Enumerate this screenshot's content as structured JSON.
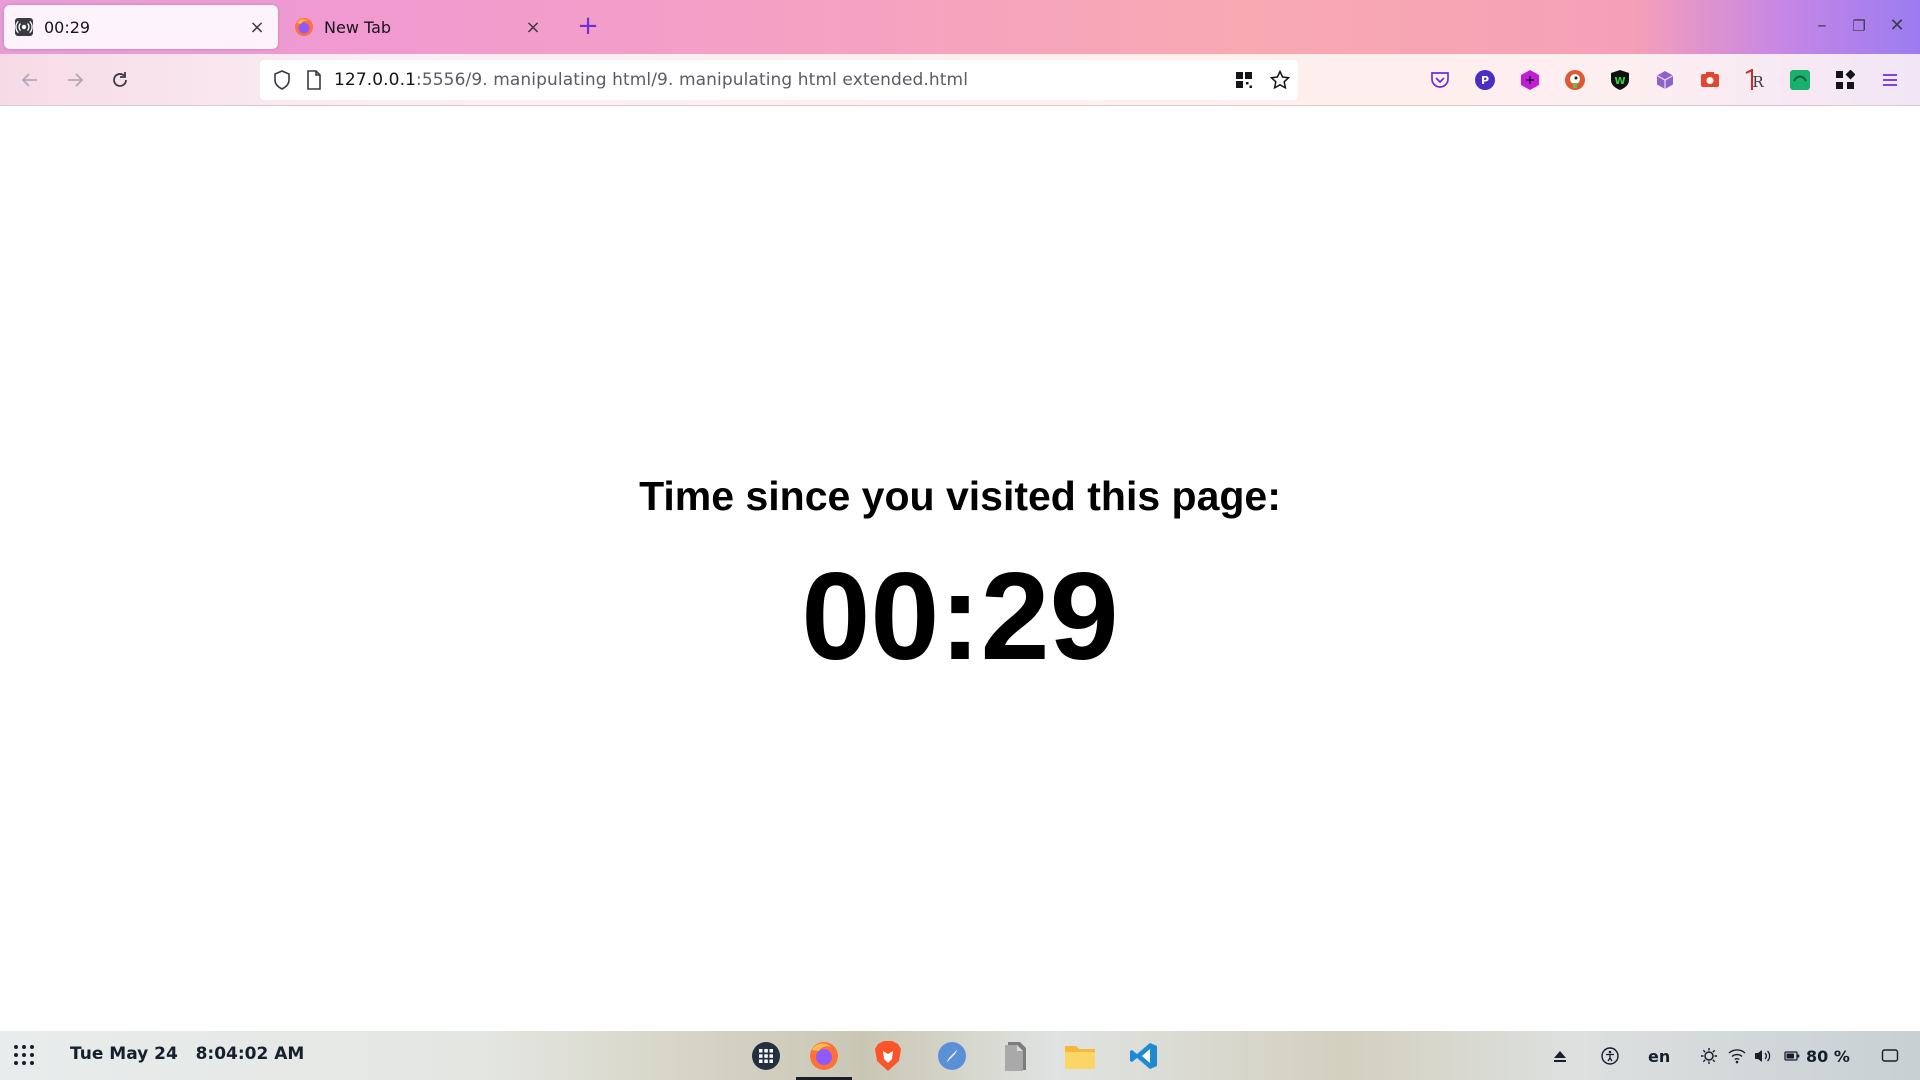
{
  "tabs": [
    {
      "title": "00:29",
      "icon": "broadcast-icon",
      "active": true
    },
    {
      "title": "New Tab",
      "icon": "firefox-icon",
      "active": false
    }
  ],
  "tab_close_glyph": "×",
  "new_tab_glyph": "+",
  "window_controls": {
    "minimize": "–",
    "restore": "❐",
    "close": "✕"
  },
  "url": {
    "host": "127.0.0.1",
    "rest": ":5556/9. manipulating html/9. manipulating html extended.html"
  },
  "extensions": [
    "pocket-icon",
    "p-extension-icon",
    "hexagon-extension-icon",
    "duckduckgo-icon",
    "shield-w-icon",
    "cube-icon",
    "camera-icon",
    "r-extension-icon",
    "green-extension-icon",
    "extensions-grid-icon",
    "menu-icon"
  ],
  "page": {
    "heading": "Time since you visited this page:",
    "timer": "00:29"
  },
  "taskbar": {
    "date": "Tue May 24",
    "time": "8:04:02 AM",
    "dock_apps": [
      "app-grid-icon",
      "firefox-icon",
      "brave-icon",
      "safari-like-icon",
      "files-doc-icon",
      "folder-icon",
      "vscode-icon"
    ],
    "language": "en",
    "battery": "80 %"
  },
  "colors": {
    "accent": "#6c2fd8",
    "text": "#15141a"
  }
}
